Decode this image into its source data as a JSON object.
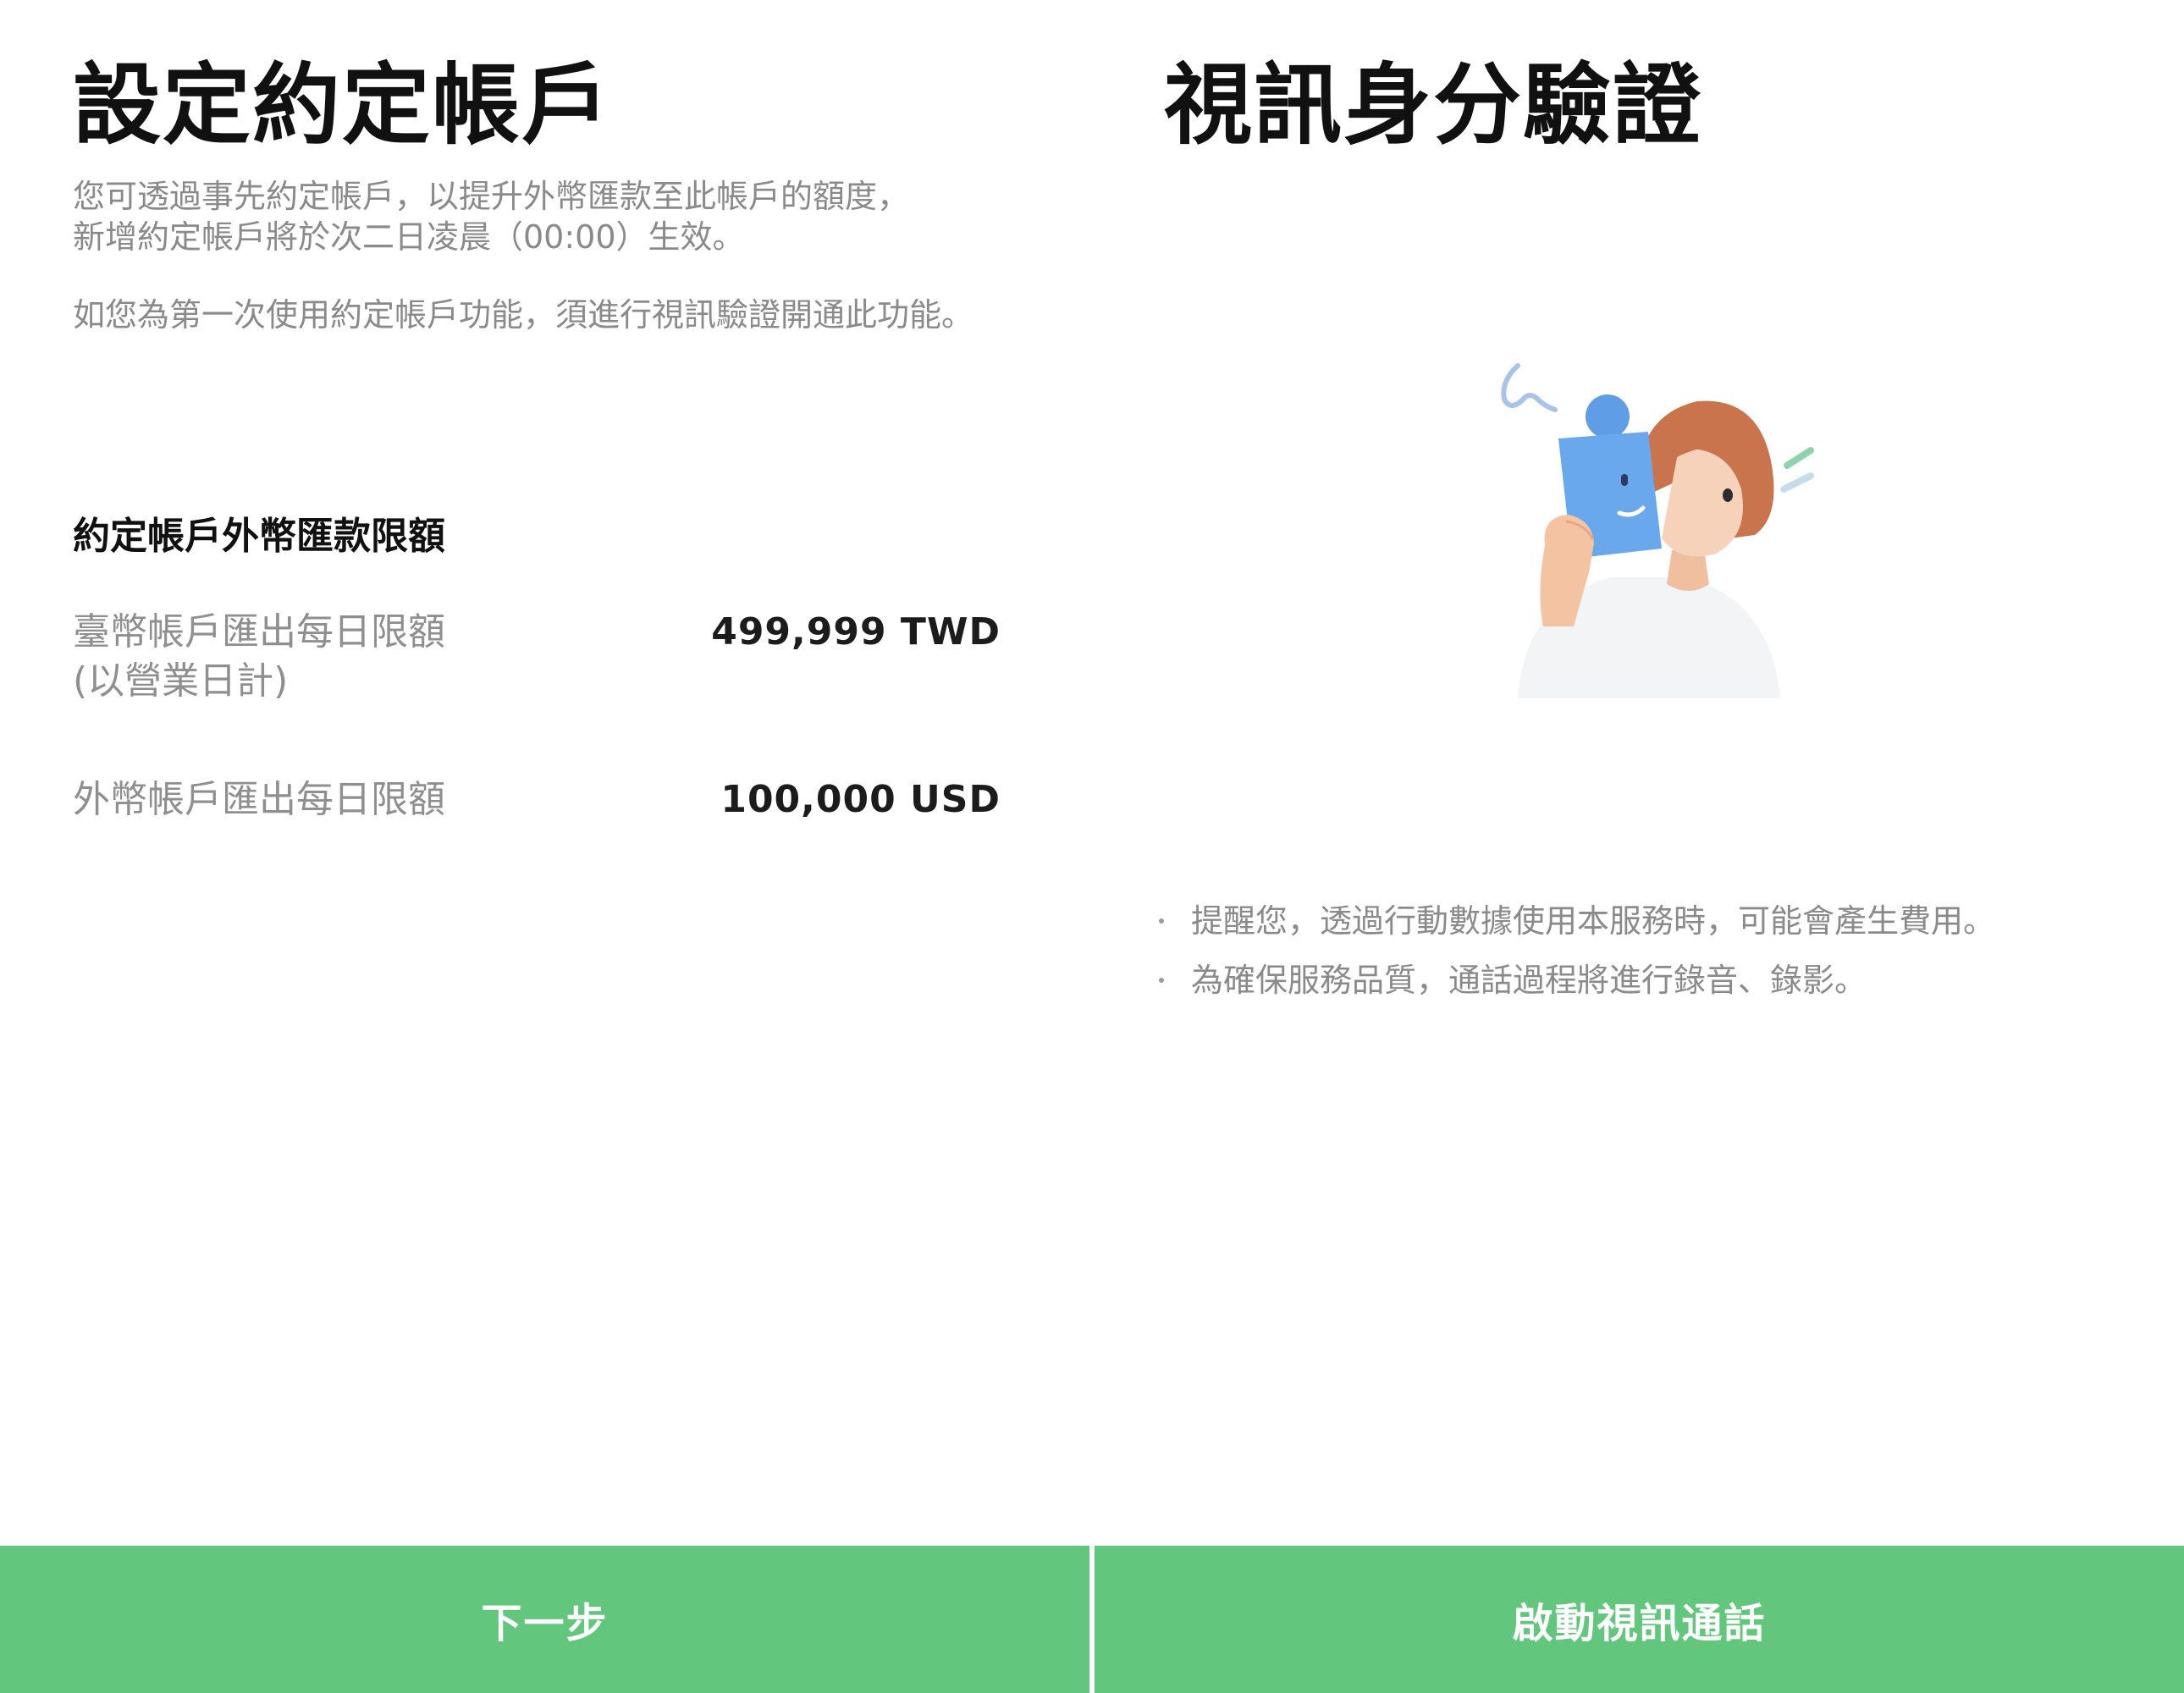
{
  "left_panel": {
    "title": "設定約定帳戶",
    "description_line1": "您可透過事先約定帳戶，以提升外幣匯款至此帳戶的額度，",
    "description_line2": "新增約定帳戶將於次二日凌晨（00:00）生效。",
    "description_line3": "如您為第一次使用約定帳戶功能，須進行視訊驗證開通此功能。",
    "limits": {
      "heading": "約定帳戶外幣匯款限額",
      "rows": [
        {
          "label_line1": "臺幣帳戶匯出每日限額",
          "label_line2": "(以營業日計)",
          "value": "499,999 TWD"
        },
        {
          "label_line1": "外幣帳戶匯出每日限額",
          "value": "100,000 USD"
        }
      ]
    },
    "next_button_label": "下一步"
  },
  "right_panel": {
    "title": "視訊身分驗證",
    "illustration": "person-holding-puzzle-piece-illustration",
    "notes": [
      "提醒您，透過行動數據使用本服務時，可能會產生費用。",
      "為確保服務品質，通話過程將進行錄音、錄影。"
    ],
    "start_call_button_label": "啟動視訊通話"
  },
  "colors": {
    "accent_green": "#62c77d",
    "title_text": "#111111",
    "secondary_text": "#8a8a8a",
    "background": "#ffffff"
  }
}
